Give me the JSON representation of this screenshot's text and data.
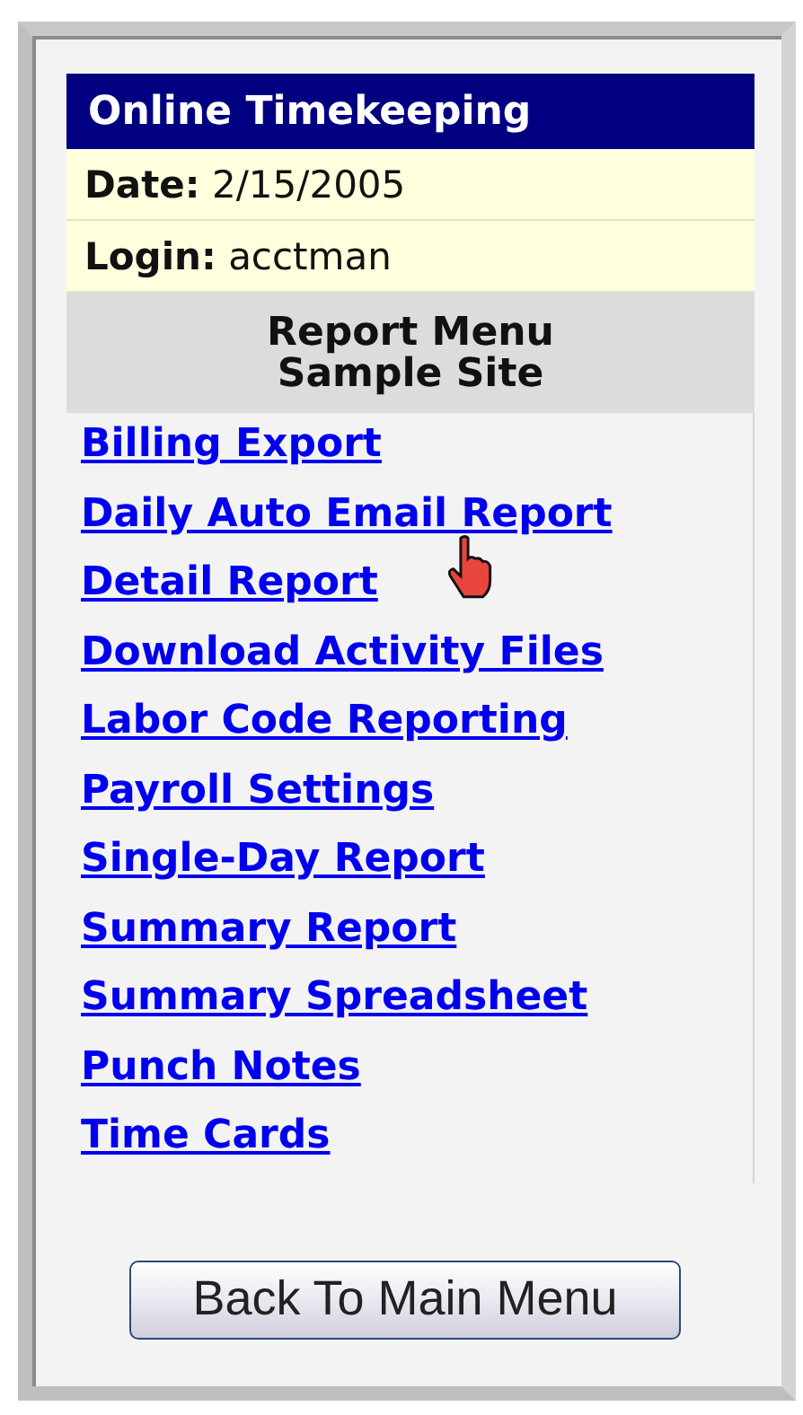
{
  "header": {
    "title": "Online Timekeeping"
  },
  "info_rows": [
    "**Date:** 2/15/2005",
    "**Login:** acctman"
  ],
  "menu_heading": [
    "Report Menu",
    "Sample Site"
  ],
  "links": [
    {
      "label": "Billing Export"
    },
    {
      "label": "Daily Auto Email Report"
    },
    {
      "label": "Detail Report"
    },
    {
      "label": "Download Activity Files"
    },
    {
      "label": "Labor Code Reporting"
    },
    {
      "label": "Payroll Settings"
    },
    {
      "label": "Single-Day Report"
    },
    {
      "label": "Summary Report"
    },
    {
      "label": "Summary Spreadsheet"
    },
    {
      "label": "Punch Notes"
    },
    {
      "label": "Time Cards"
    }
  ],
  "button": "Back To Main Menu"
}
